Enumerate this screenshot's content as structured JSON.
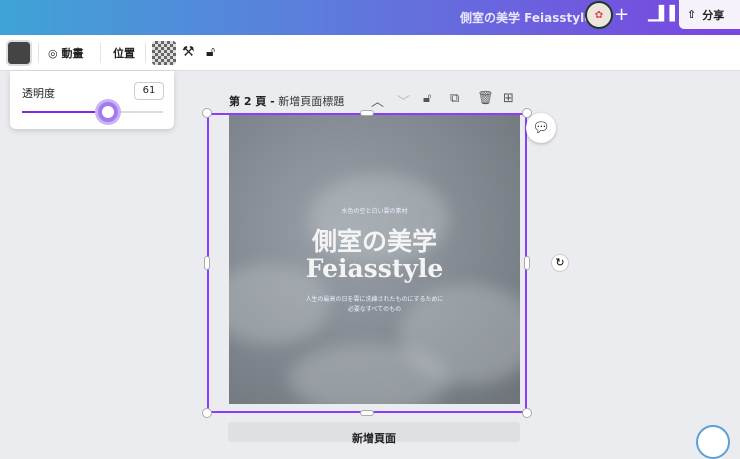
{
  "header": {
    "doc_title": "側室の美学 Feiasstyle",
    "add_icon": "+",
    "share_label": "分享"
  },
  "toolbar": {
    "animate_label": "動畫",
    "position_label": "位置"
  },
  "transparency": {
    "label": "透明度",
    "value": "61",
    "percent": 61
  },
  "page": {
    "number_label": "第 2 頁 -",
    "title_placeholder": "新增頁面標題"
  },
  "design": {
    "top_text": "水色の空と白い雲の素材",
    "title_line1": "側室の美学",
    "title_line2": "Feiasstyle",
    "sub_line1": "人生の最高の日を雲に洗練されたものにするために",
    "sub_line2": "必要なすべてのもの"
  },
  "footer": {
    "add_page_label": "新增頁面"
  }
}
